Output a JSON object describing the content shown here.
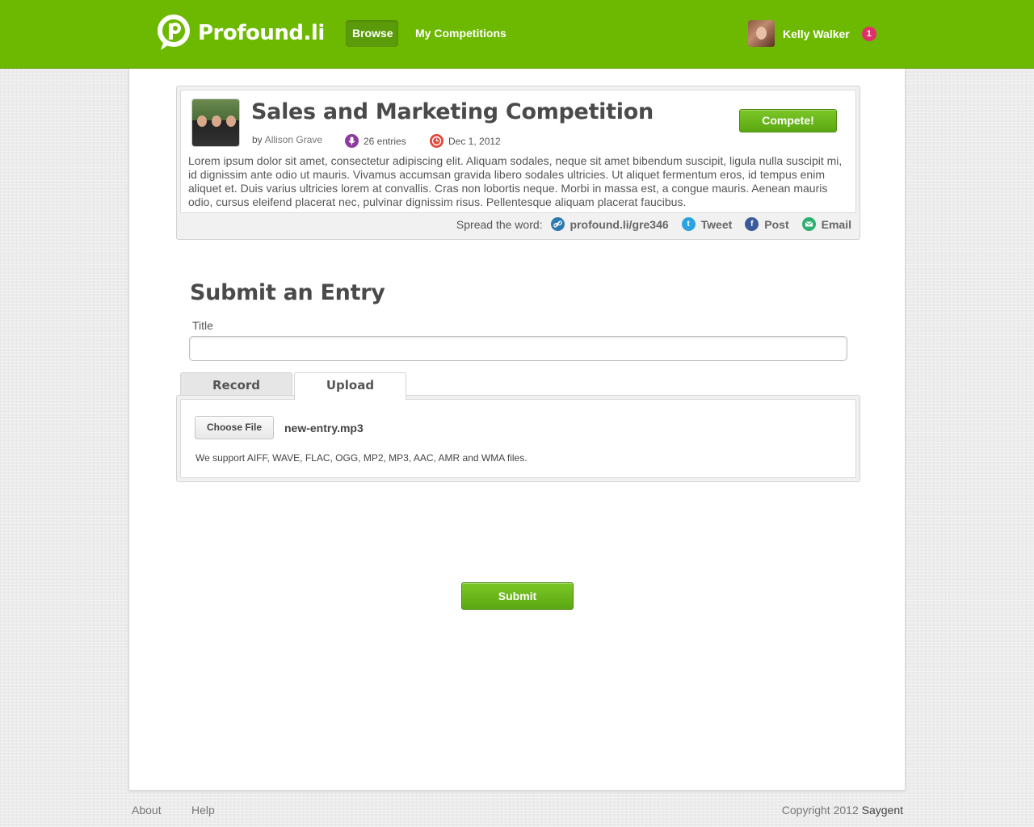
{
  "header": {
    "brand": "Profound.li",
    "nav": [
      {
        "label": "Browse"
      },
      {
        "label": "My Competitions"
      }
    ],
    "user": {
      "name": "Kelly Walker",
      "notifications": "1"
    }
  },
  "competition": {
    "title": "Sales and Marketing Competition",
    "by_prefix": "by",
    "author": "Allison Grave",
    "entries": "26 entries",
    "date": "Dec 1, 2012",
    "compete_label": "Compete!",
    "description": "Lorem ipsum dolor sit amet, consectetur adipiscing elit. Aliquam sodales, neque sit amet bibendum suscipit, ligula nulla suscipit mi, id dignissim ante odio ut mauris. Vivamus accumsan gravida libero sodales ultricies. Ut aliquet fermentum eros, id tempus enim aliquet et. Duis varius ultricies lorem at convallis. Cras non lobortis neque. Morbi in massa est, a congue mauris. Aenean mauris odio, cursus eleifend placerat nec, pulvinar dignissim risus. Pellentesque aliquam placerat faucibus.",
    "spread_label": "Spread the word:",
    "short_link": "profound.li/gre346",
    "share": {
      "tweet": "Tweet",
      "post": "Post",
      "email": "Email"
    }
  },
  "entry_form": {
    "heading": "Submit an Entry",
    "title_label": "Title",
    "title_value": "",
    "tabs": [
      {
        "label": "Record",
        "active": false
      },
      {
        "label": "Upload",
        "active": true
      }
    ],
    "choose_file_label": "Choose File",
    "file_name": "new-entry.mp3",
    "formats_note": "We support AIFF, WAVE, FLAC, OGG, MP2, MP3, AAC, AMR and WMA files.",
    "submit_label": "Submit"
  },
  "footer": {
    "links": [
      {
        "label": "About"
      },
      {
        "label": "Help"
      }
    ],
    "copyright": "Copyright 2012",
    "company": "Saygent"
  },
  "icons": {
    "logo": "profound-logo-icon",
    "entries": "microphone-icon",
    "date": "clock-icon",
    "link": "link-icon",
    "tweet": "twitter-icon",
    "post": "facebook-icon",
    "email": "email-icon"
  },
  "colors": {
    "brand_green": "#6db800",
    "button_green": "#5aa812",
    "notification": "#e0306a",
    "mic_purple": "#8e3a9e",
    "clock_red": "#e0483a"
  }
}
